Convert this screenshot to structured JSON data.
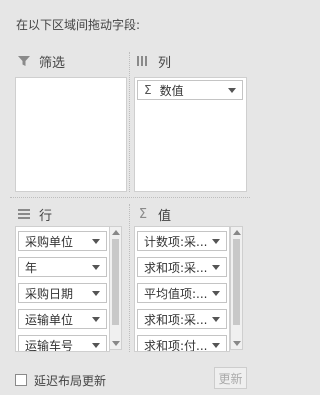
{
  "instruction": "在以下区域间拖动字段:",
  "filters": {
    "title": "筛选",
    "icon": "filter-icon",
    "items": []
  },
  "columns": {
    "title": "列",
    "icon": "columns-icon",
    "items": [
      {
        "label": "数值",
        "prefix": "Σ"
      }
    ]
  },
  "rows": {
    "title": "行",
    "icon": "rows-icon",
    "items": [
      {
        "label": "采购单位"
      },
      {
        "label": "年"
      },
      {
        "label": "采购日期"
      },
      {
        "label": "运输单位"
      },
      {
        "label": "运输车号"
      }
    ]
  },
  "values": {
    "title": "值",
    "icon": "sigma-icon",
    "symbol": "Σ",
    "items": [
      {
        "label": "计数项:采..."
      },
      {
        "label": "求和项:采..."
      },
      {
        "label": "平均值项:..."
      },
      {
        "label": "求和项:采..."
      },
      {
        "label": "求和项:付..."
      }
    ]
  },
  "footer": {
    "defer_label": "延迟布局更新",
    "defer_checked": false,
    "update_label": "更新"
  }
}
